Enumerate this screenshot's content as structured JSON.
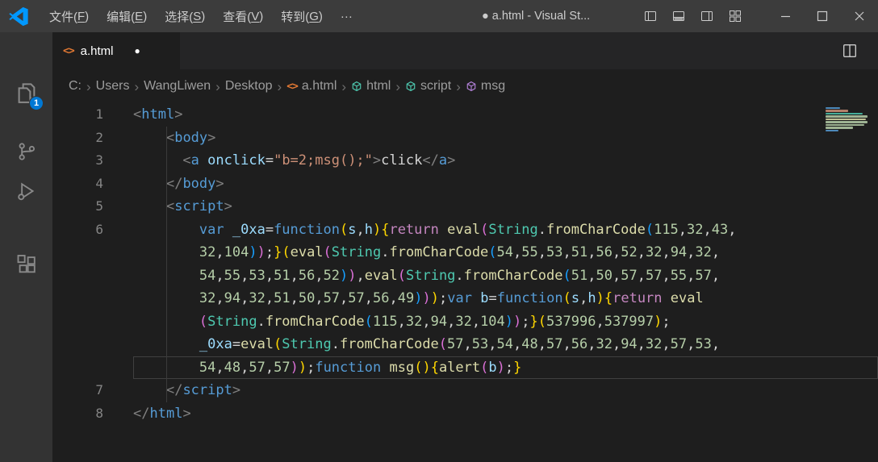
{
  "colors": {
    "accent": "#0078d4",
    "titlebar_bg": "#3c3c3c",
    "activitybar_bg": "#333333",
    "tabbar_bg": "#252526",
    "editor_bg": "#1e1e1e",
    "token": {
      "txt": "#d4d4d4",
      "pun": "#808080",
      "tag": "#569cd6",
      "attr": "#9cdcfe",
      "str": "#ce9178",
      "kw": "#569cd6",
      "ctrl": "#c586c0",
      "fn": "#dcdcaa",
      "cls": "#4ec9b0",
      "num": "#b5cea8",
      "br1": "#ffd700",
      "br2": "#da70d6",
      "br3": "#179fff"
    }
  },
  "titlebar": {
    "menus": [
      "文件(F)",
      "编辑(E)",
      "选择(S)",
      "查看(V)",
      "转到(G)",
      "···"
    ],
    "title": "● a.html - Visual St..."
  },
  "activity_bar": {
    "items": [
      {
        "name": "explorer",
        "badge": "1"
      },
      {
        "name": "source-control"
      },
      {
        "name": "run-and-debug"
      },
      {
        "name": "extensions"
      }
    ]
  },
  "tabbar": {
    "tab": {
      "label": "a.html",
      "icon_glyph": "<>",
      "dirty": "●"
    }
  },
  "breadcrumbs": [
    {
      "label": "C:"
    },
    {
      "label": "Users"
    },
    {
      "label": "WangLiwen"
    },
    {
      "label": "Desktop"
    },
    {
      "label": "a.html",
      "icon": "html"
    },
    {
      "label": "html",
      "icon": "symbol-teal"
    },
    {
      "label": "script",
      "icon": "symbol-teal"
    },
    {
      "label": "msg",
      "icon": "symbol-purple"
    }
  ],
  "editor": {
    "rows": [
      {
        "n": "1",
        "tokens": [
          [
            "<",
            "pun"
          ],
          [
            "html",
            "tag"
          ],
          [
            ">",
            "pun"
          ]
        ]
      },
      {
        "n": "2",
        "tokens": [
          [
            "    ",
            "txt"
          ],
          [
            "<",
            "pun"
          ],
          [
            "body",
            "tag"
          ],
          [
            ">",
            "pun"
          ]
        ]
      },
      {
        "n": "3",
        "tokens": [
          [
            "      ",
            "txt"
          ],
          [
            "<",
            "pun"
          ],
          [
            "a",
            "tag"
          ],
          [
            " ",
            "txt"
          ],
          [
            "onclick",
            "attr"
          ],
          [
            "=",
            "txt"
          ],
          [
            "\"b=2;msg();\"",
            "str"
          ],
          [
            ">",
            "pun"
          ],
          [
            "click",
            "txt"
          ],
          [
            "</",
            "pun"
          ],
          [
            "a",
            "tag"
          ],
          [
            ">",
            "pun"
          ]
        ]
      },
      {
        "n": "4",
        "tokens": [
          [
            "    ",
            "txt"
          ],
          [
            "</",
            "pun"
          ],
          [
            "body",
            "tag"
          ],
          [
            ">",
            "pun"
          ]
        ]
      },
      {
        "n": "5",
        "tokens": [
          [
            "    ",
            "txt"
          ],
          [
            "<",
            "pun"
          ],
          [
            "script",
            "tag"
          ],
          [
            ">",
            "pun"
          ]
        ]
      },
      {
        "n": "6",
        "tokens": [
          [
            "        ",
            "txt"
          ],
          [
            "var",
            "kw"
          ],
          [
            " ",
            "txt"
          ],
          [
            "_0xa",
            "attr"
          ],
          [
            "=",
            "txt"
          ],
          [
            "function",
            "kw"
          ],
          [
            "(",
            "br1"
          ],
          [
            "s",
            "attr"
          ],
          [
            ",",
            "txt"
          ],
          [
            "h",
            "attr"
          ],
          [
            ")",
            "br1"
          ],
          [
            "{",
            "br1"
          ],
          [
            "return",
            "ctrl"
          ],
          [
            " ",
            "txt"
          ],
          [
            "eval",
            "fn"
          ],
          [
            "(",
            "br2"
          ],
          [
            "String",
            "cls"
          ],
          [
            ".",
            "txt"
          ],
          [
            "fromCharCode",
            "fn"
          ],
          [
            "(",
            "br3"
          ],
          [
            "115,32,43,",
            "nums"
          ]
        ]
      },
      {
        "n": "",
        "tokens": [
          [
            "        ",
            "txt"
          ],
          [
            "32,104",
            "nums"
          ],
          [
            ")",
            "br3"
          ],
          [
            ")",
            "br2"
          ],
          [
            ";",
            "txt"
          ],
          [
            "}",
            "br1"
          ],
          [
            "(",
            "br1"
          ],
          [
            "eval",
            "fn"
          ],
          [
            "(",
            "br2"
          ],
          [
            "String",
            "cls"
          ],
          [
            ".",
            "txt"
          ],
          [
            "fromCharCode",
            "fn"
          ],
          [
            "(",
            "br3"
          ],
          [
            "54,55,53,51,56,52,32,94,32,",
            "nums"
          ]
        ]
      },
      {
        "n": "",
        "tokens": [
          [
            "        ",
            "txt"
          ],
          [
            "54,55,53,51,56,52",
            "nums"
          ],
          [
            ")",
            "br3"
          ],
          [
            ")",
            "br2"
          ],
          [
            ",",
            "txt"
          ],
          [
            "eval",
            "fn"
          ],
          [
            "(",
            "br2"
          ],
          [
            "String",
            "cls"
          ],
          [
            ".",
            "txt"
          ],
          [
            "fromCharCode",
            "fn"
          ],
          [
            "(",
            "br3"
          ],
          [
            "51,50,57,57,55,57,",
            "nums"
          ]
        ]
      },
      {
        "n": "",
        "tokens": [
          [
            "        ",
            "txt"
          ],
          [
            "32,94,32,51,50,57,57,56,49",
            "nums"
          ],
          [
            ")",
            "br3"
          ],
          [
            ")",
            "br2"
          ],
          [
            ")",
            "br1"
          ],
          [
            ";",
            "txt"
          ],
          [
            "var",
            "kw"
          ],
          [
            " ",
            "txt"
          ],
          [
            "b",
            "attr"
          ],
          [
            "=",
            "txt"
          ],
          [
            "function",
            "kw"
          ],
          [
            "(",
            "br1"
          ],
          [
            "s",
            "attr"
          ],
          [
            ",",
            "txt"
          ],
          [
            "h",
            "attr"
          ],
          [
            ")",
            "br1"
          ],
          [
            "{",
            "br1"
          ],
          [
            "return",
            "ctrl"
          ],
          [
            " ",
            "txt"
          ],
          [
            "eval",
            "fn"
          ]
        ]
      },
      {
        "n": "",
        "tokens": [
          [
            "        ",
            "txt"
          ],
          [
            "(",
            "br2"
          ],
          [
            "String",
            "cls"
          ],
          [
            ".",
            "txt"
          ],
          [
            "fromCharCode",
            "fn"
          ],
          [
            "(",
            "br3"
          ],
          [
            "115,32,94,32,104",
            "nums"
          ],
          [
            ")",
            "br3"
          ],
          [
            ")",
            "br2"
          ],
          [
            ";",
            "txt"
          ],
          [
            "}",
            "br1"
          ],
          [
            "(",
            "br1"
          ],
          [
            "537996,537997",
            "nums"
          ],
          [
            ")",
            "br1"
          ],
          [
            ";",
            "txt"
          ]
        ]
      },
      {
        "n": "",
        "tokens": [
          [
            "        ",
            "txt"
          ],
          [
            "_0xa",
            "attr"
          ],
          [
            "=",
            "txt"
          ],
          [
            "eval",
            "fn"
          ],
          [
            "(",
            "br1"
          ],
          [
            "String",
            "cls"
          ],
          [
            ".",
            "txt"
          ],
          [
            "fromCharCode",
            "fn"
          ],
          [
            "(",
            "br2"
          ],
          [
            "57,53,54,48,57,56,32,94,32,57,53,",
            "nums"
          ]
        ]
      },
      {
        "n": "",
        "cur": true,
        "tokens": [
          [
            "        ",
            "txt"
          ],
          [
            "54,48,57,57",
            "nums"
          ],
          [
            ")",
            "br2"
          ],
          [
            ")",
            "br1"
          ],
          [
            ";",
            "txt"
          ],
          [
            "function",
            "kw"
          ],
          [
            " ",
            "txt"
          ],
          [
            "msg",
            "fn"
          ],
          [
            "(",
            "br1"
          ],
          [
            ")",
            "br1"
          ],
          [
            "{",
            "br1"
          ],
          [
            "alert",
            "fn"
          ],
          [
            "(",
            "br2"
          ],
          [
            "b",
            "attr"
          ],
          [
            ")",
            "br2"
          ],
          [
            ";",
            "txt"
          ],
          [
            "}",
            "br1"
          ]
        ]
      },
      {
        "n": "7",
        "tokens": [
          [
            "    ",
            "txt"
          ],
          [
            "</",
            "pun"
          ],
          [
            "script",
            "tag"
          ],
          [
            ">",
            "pun"
          ]
        ]
      },
      {
        "n": "8",
        "tokens": [
          [
            "</",
            "pun"
          ],
          [
            "html",
            "tag"
          ],
          [
            ">",
            "pun"
          ]
        ]
      }
    ]
  },
  "minimap": {
    "rows": [
      [
        18,
        "tag"
      ],
      [
        28,
        "str"
      ],
      [
        46,
        "cls"
      ],
      [
        52,
        "num"
      ],
      [
        50,
        "fn"
      ],
      [
        52,
        "num"
      ],
      [
        48,
        "num"
      ],
      [
        34,
        "num"
      ],
      [
        16,
        "tag"
      ]
    ]
  }
}
